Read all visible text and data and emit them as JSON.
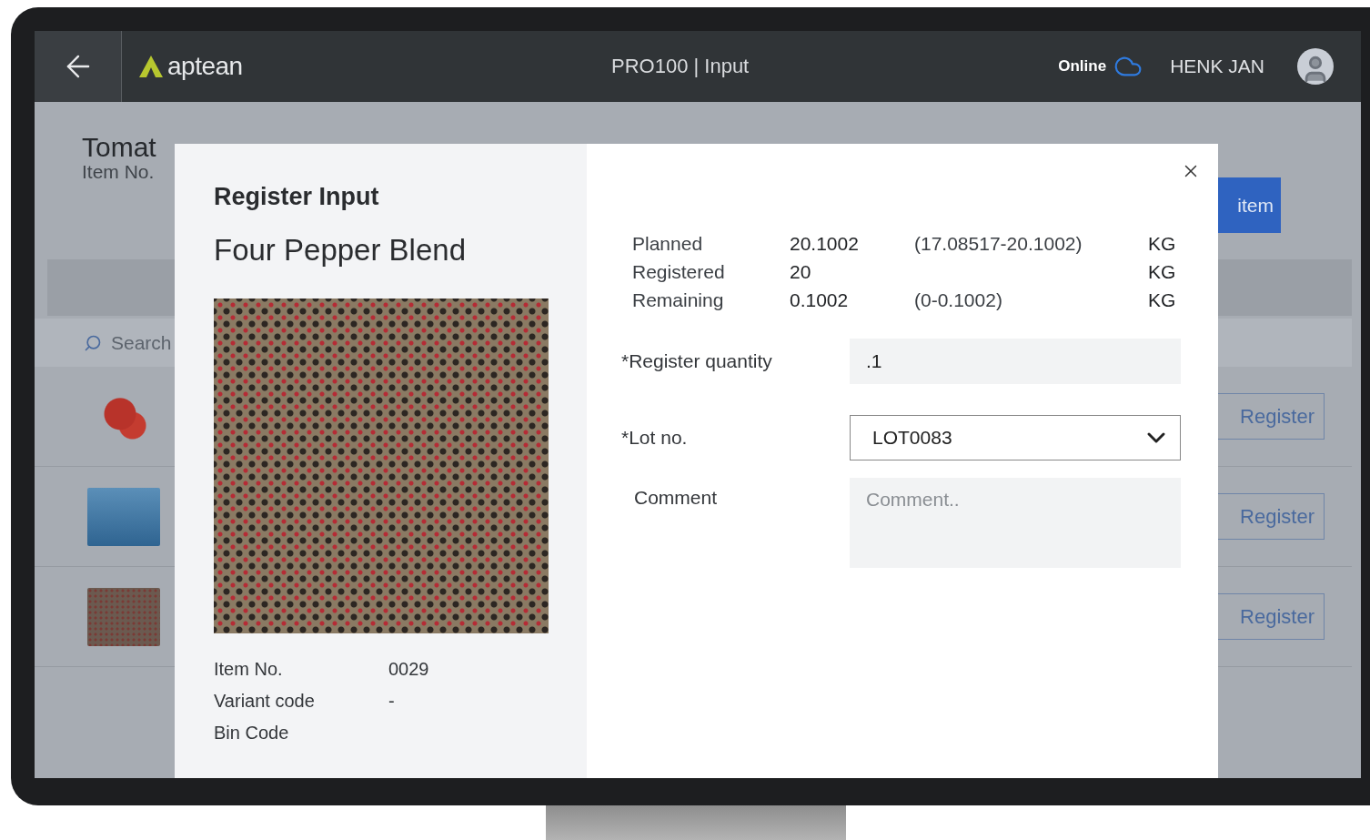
{
  "topbar": {
    "logo_text": "aptean",
    "title": "PRO100 | Input",
    "status": "Online",
    "user": "HENK JAN"
  },
  "background": {
    "title": "Tomat",
    "subtitle": "Item No.",
    "action": "item",
    "search_placeholder": "Search",
    "rows": [
      {
        "kind": "tomato",
        "button": "Register"
      },
      {
        "kind": "water",
        "button": "Register"
      },
      {
        "kind": "pepper",
        "button": "Register"
      }
    ]
  },
  "dialog": {
    "heading": "Register Input",
    "item_name": "Four Pepper Blend",
    "details": [
      {
        "label": "Item No.",
        "value": "0029"
      },
      {
        "label": "Variant code",
        "value": "-"
      },
      {
        "label": "Bin Code"
      }
    ],
    "quantities": [
      {
        "label": "Planned",
        "value": "20.1002",
        "range": "(17.08517-20.1002)",
        "unit": "KG"
      },
      {
        "label": "Registered",
        "value": "20",
        "unit": "KG"
      },
      {
        "label": "Remaining",
        "value": "0.1002",
        "range": "(0-0.1002)",
        "unit": "KG"
      }
    ],
    "fields": [
      {
        "kind": "input",
        "label": "*Register quantity",
        "value": ".1"
      },
      {
        "kind": "select",
        "label": "*Lot no.",
        "value": "LOT0083"
      },
      {
        "kind": "textarea",
        "label": "Comment",
        "placeholder": "Comment.."
      }
    ]
  }
}
